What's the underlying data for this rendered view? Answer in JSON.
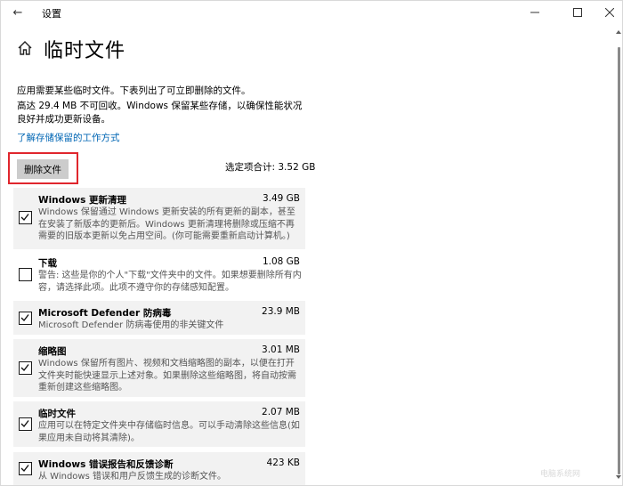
{
  "window": {
    "app_title": "设置",
    "back_glyph": "←",
    "minimize_glyph": "—",
    "maximize_glyph": "☐",
    "close_glyph": "✕"
  },
  "header": {
    "title": "临时文件",
    "home_icon": "home-icon"
  },
  "intro": {
    "line1": "应用需要某些临时文件。下表列出了可立即删除的文件。",
    "line2": "高达 29.4 MB 不可回收。Windows 保留某些存储，以确保性能状况良好并成功更新设备。",
    "link": "了解存储保留的工作方式"
  },
  "actions": {
    "delete_label": "删除文件",
    "highlight_color": "#e0262d",
    "total_label": "选定项合计: 3.52 GB"
  },
  "items": [
    {
      "name": "Windows 更新清理",
      "size": "3.49 GB",
      "checked": true,
      "desc": "Windows 保留通过 Windows 更新安装的所有更新的副本，甚至在安装了新版本的更新后。Windows 更新清理将删除或压缩不再需要的旧版本更新以免占用空间。(你可能需要重新启动计算机。)"
    },
    {
      "name": "下载",
      "size": "1.08 GB",
      "checked": false,
      "desc": "警告: 这些是你的个人\"下载\"文件夹中的文件。如果想要删除所有内容，请选择此项。此项不遵守你的存储感知配置。"
    },
    {
      "name": "Microsoft Defender 防病毒",
      "size": "23.9 MB",
      "checked": true,
      "desc": "Microsoft Defender 防病毒使用的非关键文件"
    },
    {
      "name": "缩略图",
      "size": "3.01 MB",
      "checked": true,
      "desc": "Windows 保留所有图片、视频和文档缩略图的副本，以便在打开文件夹时能快速显示上述对象。如果删除这些缩略图，将自动按需重新创建这些缩略图。"
    },
    {
      "name": "临时文件",
      "size": "2.07 MB",
      "checked": true,
      "desc": "应用可以在特定文件夹中存储临时信息。可以手动清除这些信息(如果应用未自动将其清除)。"
    },
    {
      "name": "Windows 错误报告和反馈诊断",
      "size": "423 KB",
      "checked": true,
      "desc": "从 Windows 错误和用户反馈生成的诊断文件。"
    }
  ],
  "watermark": "电脑系统网"
}
